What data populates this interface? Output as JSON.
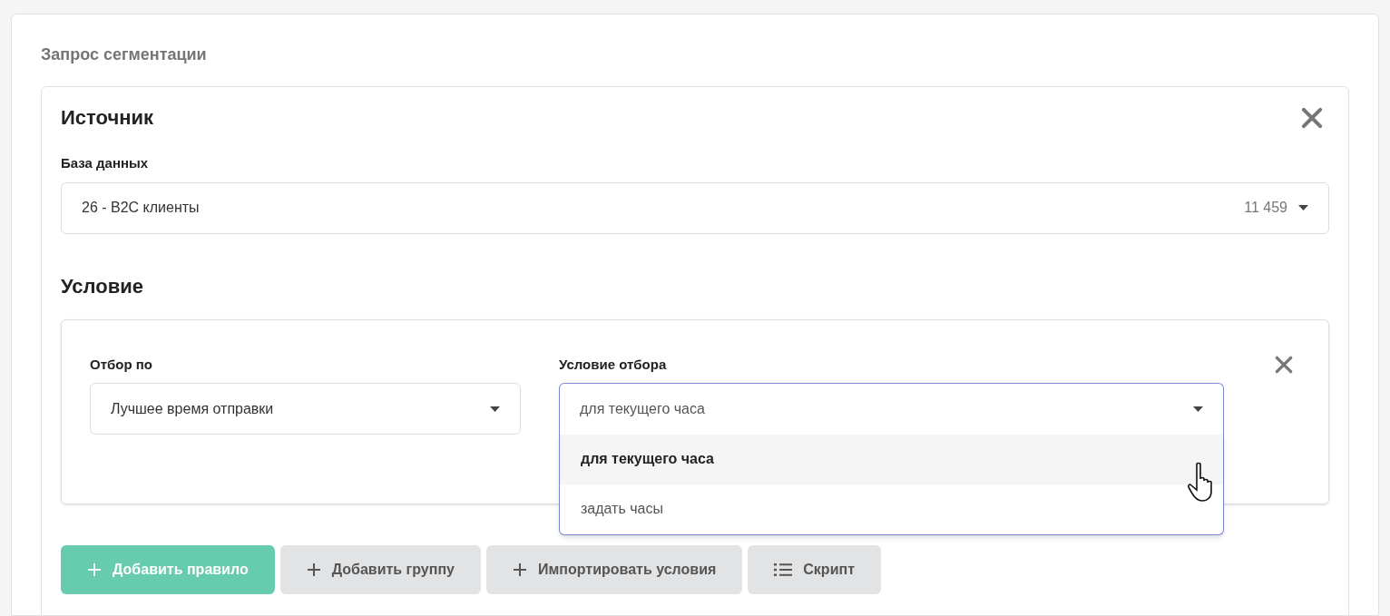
{
  "page_title": "Запрос сегментации",
  "source": {
    "heading": "Источник",
    "field_label": "База данных",
    "database": {
      "value": "26 - B2C клиенты",
      "count": "11 459"
    }
  },
  "condition": {
    "heading": "Условие",
    "rule": {
      "filter_by": {
        "label": "Отбор по",
        "value": "Лучшее время отправки"
      },
      "filter_condition": {
        "label": "Условие отбора",
        "value": "для текущего часа",
        "expanded": true,
        "options": [
          {
            "label": "для текущего часа",
            "selected": true
          },
          {
            "label": "задать часы",
            "selected": false
          }
        ]
      }
    }
  },
  "buttons": [
    {
      "label": "Добавить правило",
      "kind": "primary"
    },
    {
      "label": "Добавить группу",
      "kind": "secondary"
    },
    {
      "label": "Импортировать условия",
      "kind": "secondary"
    },
    {
      "label": "Скрипт",
      "kind": "script"
    }
  ]
}
